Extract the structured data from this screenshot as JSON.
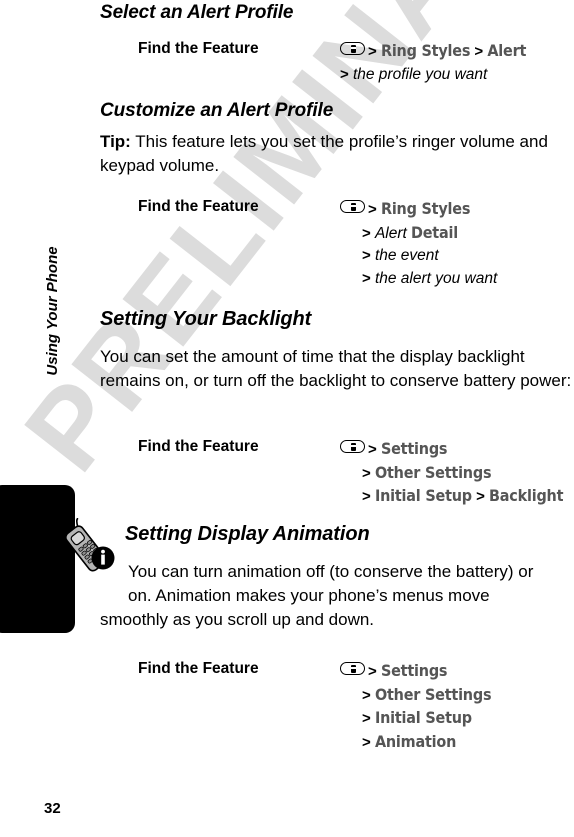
{
  "page": {
    "number": "32",
    "chapter_label": "Using Your Phone",
    "watermark": "PRELIMINARY",
    "watermark_color": "#dcdcdc",
    "menu_name_color": "#555555",
    "background_color": "#ffffff"
  },
  "icons": {
    "menu_key": "menu-key-icon",
    "note": "phone-info-note-icon",
    "chapter_tab": "chapter-tab"
  },
  "find_the_feature_label": "Find the Feature",
  "sections": [
    {
      "title": "Select an Alert Profile",
      "find_the_feature": {
        "label": "Find the Feature",
        "rows": [
          [
            {
              "type": "menukey"
            },
            {
              "type": "gt",
              "text": ">"
            },
            {
              "type": "menu",
              "text": "Ring Styles"
            },
            {
              "type": "gt",
              "text": ">"
            },
            {
              "type": "menu",
              "text": "Alert"
            }
          ],
          [
            {
              "type": "gt",
              "text": ">"
            },
            {
              "type": "var",
              "text": "the profile you want"
            }
          ]
        ]
      }
    },
    {
      "title": "Customize an Alert Profile",
      "body": [
        {
          "lead": "Tip:",
          "text": " This feature lets you set the profile’s ringer volume and keypad volume."
        }
      ],
      "find_the_feature": {
        "label": "Find the Feature",
        "rows": [
          [
            {
              "type": "menukey"
            },
            {
              "type": "gt",
              "text": ">"
            },
            {
              "type": "menu",
              "text": "Ring Styles"
            }
          ],
          [
            {
              "type": "gt",
              "text": ">"
            },
            {
              "type": "var",
              "text": "Alert"
            },
            {
              "type": "menu",
              "text": "Detail"
            }
          ],
          [
            {
              "type": "gt",
              "text": ">"
            },
            {
              "type": "var",
              "text": "the event"
            }
          ],
          [
            {
              "type": "gt",
              "text": ">"
            },
            {
              "type": "var",
              "text": "the alert you want"
            }
          ]
        ]
      }
    },
    {
      "title": "Setting Your Backlight",
      "body": [
        {
          "lead": "",
          "text": "You can set the amount of time that the display backlight remains on, or turn off the backlight to conserve battery power:"
        }
      ],
      "find_the_feature": {
        "label": "Find the Feature",
        "rows": [
          [
            {
              "type": "menukey"
            },
            {
              "type": "gt",
              "text": ">"
            },
            {
              "type": "menu",
              "text": "Settings"
            }
          ],
          [
            {
              "type": "gt",
              "text": ">"
            },
            {
              "type": "menu",
              "text": "Other Settings"
            }
          ],
          [
            {
              "type": "gt",
              "text": ">"
            },
            {
              "type": "menu",
              "text": "Initial Setup"
            },
            {
              "type": "gt",
              "text": ">"
            },
            {
              "type": "menu",
              "text": "Backlight"
            }
          ]
        ]
      }
    },
    {
      "title": "Setting Display Animation",
      "body": [
        {
          "lead": "",
          "text": "You can turn animation off (to conserve the battery) or on. Animation makes your phone’s menus move smoothly as you scroll up and down."
        }
      ],
      "find_the_feature": {
        "label": "Find the Feature",
        "rows": [
          [
            {
              "type": "menukey"
            },
            {
              "type": "gt",
              "text": ">"
            },
            {
              "type": "menu",
              "text": "Settings"
            }
          ],
          [
            {
              "type": "gt",
              "text": ">"
            },
            {
              "type": "menu",
              "text": "Other Settings"
            }
          ],
          [
            {
              "type": "gt",
              "text": ">"
            },
            {
              "type": "menu",
              "text": "Initial Setup"
            }
          ],
          [
            {
              "type": "gt",
              "text": ">"
            },
            {
              "type": "menu",
              "text": "Animation"
            }
          ]
        ]
      }
    }
  ],
  "text_fragments": {
    "s1_title": "Select an Alert Profile",
    "s1_ftf": "Find the Feature",
    "s1_r1_gt1": ">",
    "s1_r1_m1": "Ring Styles",
    "s1_r1_gt2": ">",
    "s1_r1_m2": "Alert",
    "s1_r2_gt1": ">",
    "s1_r2_v1": "the profile you want",
    "s2_title": "Customize an Alert Profile",
    "s2_tip_lead": "Tip:",
    "s2_tip_l1": " This feature lets you set the profile’s ringer volume",
    "s2_tip_l2": "and keypad volume.",
    "s2_ftf": "Find the Feature",
    "s2_r1_gt1": ">",
    "s2_r1_m1": "Ring Styles",
    "s2_r2_gt1": ">",
    "s2_r2_v1": "Alert",
    "s2_r2_m1": "Detail",
    "s2_r3_gt1": ">",
    "s2_r3_v1": "the event",
    "s2_r4_gt1": ">",
    "s2_r4_v1": "the alert you want",
    "s3_title": "Setting Your Backlight",
    "s3_l1": "You can set the amount of time that the display backlight",
    "s3_l2": "remains on, or turn off the backlight to conserve battery",
    "s3_l3": "power:",
    "s3_ftf": "Find the Feature",
    "s3_r1_gt1": ">",
    "s3_r1_m1": "Settings",
    "s3_r2_gt1": ">",
    "s3_r2_m1": "Other Settings",
    "s3_r3_gt1": ">",
    "s3_r3_m1": "Initial Setup",
    "s3_r3_gt2": ">",
    "s3_r3_m2": "Backlight",
    "s4_title": "Setting Display Animation",
    "s4_l1": "You can turn animation off (to conserve the battery) or",
    "s4_l2": "on. Animation makes your phone’s menus move",
    "s4_l3": "smoothly as you scroll up and down.",
    "s4_ftf": "Find the Feature",
    "s4_r1_gt1": ">",
    "s4_r1_m1": "Settings",
    "s4_r2_gt1": ">",
    "s4_r2_m1": "Other Settings",
    "s4_r3_gt1": ">",
    "s4_r3_m1": "Initial Setup",
    "s4_r4_gt1": ">",
    "s4_r4_m1": "Animation"
  }
}
